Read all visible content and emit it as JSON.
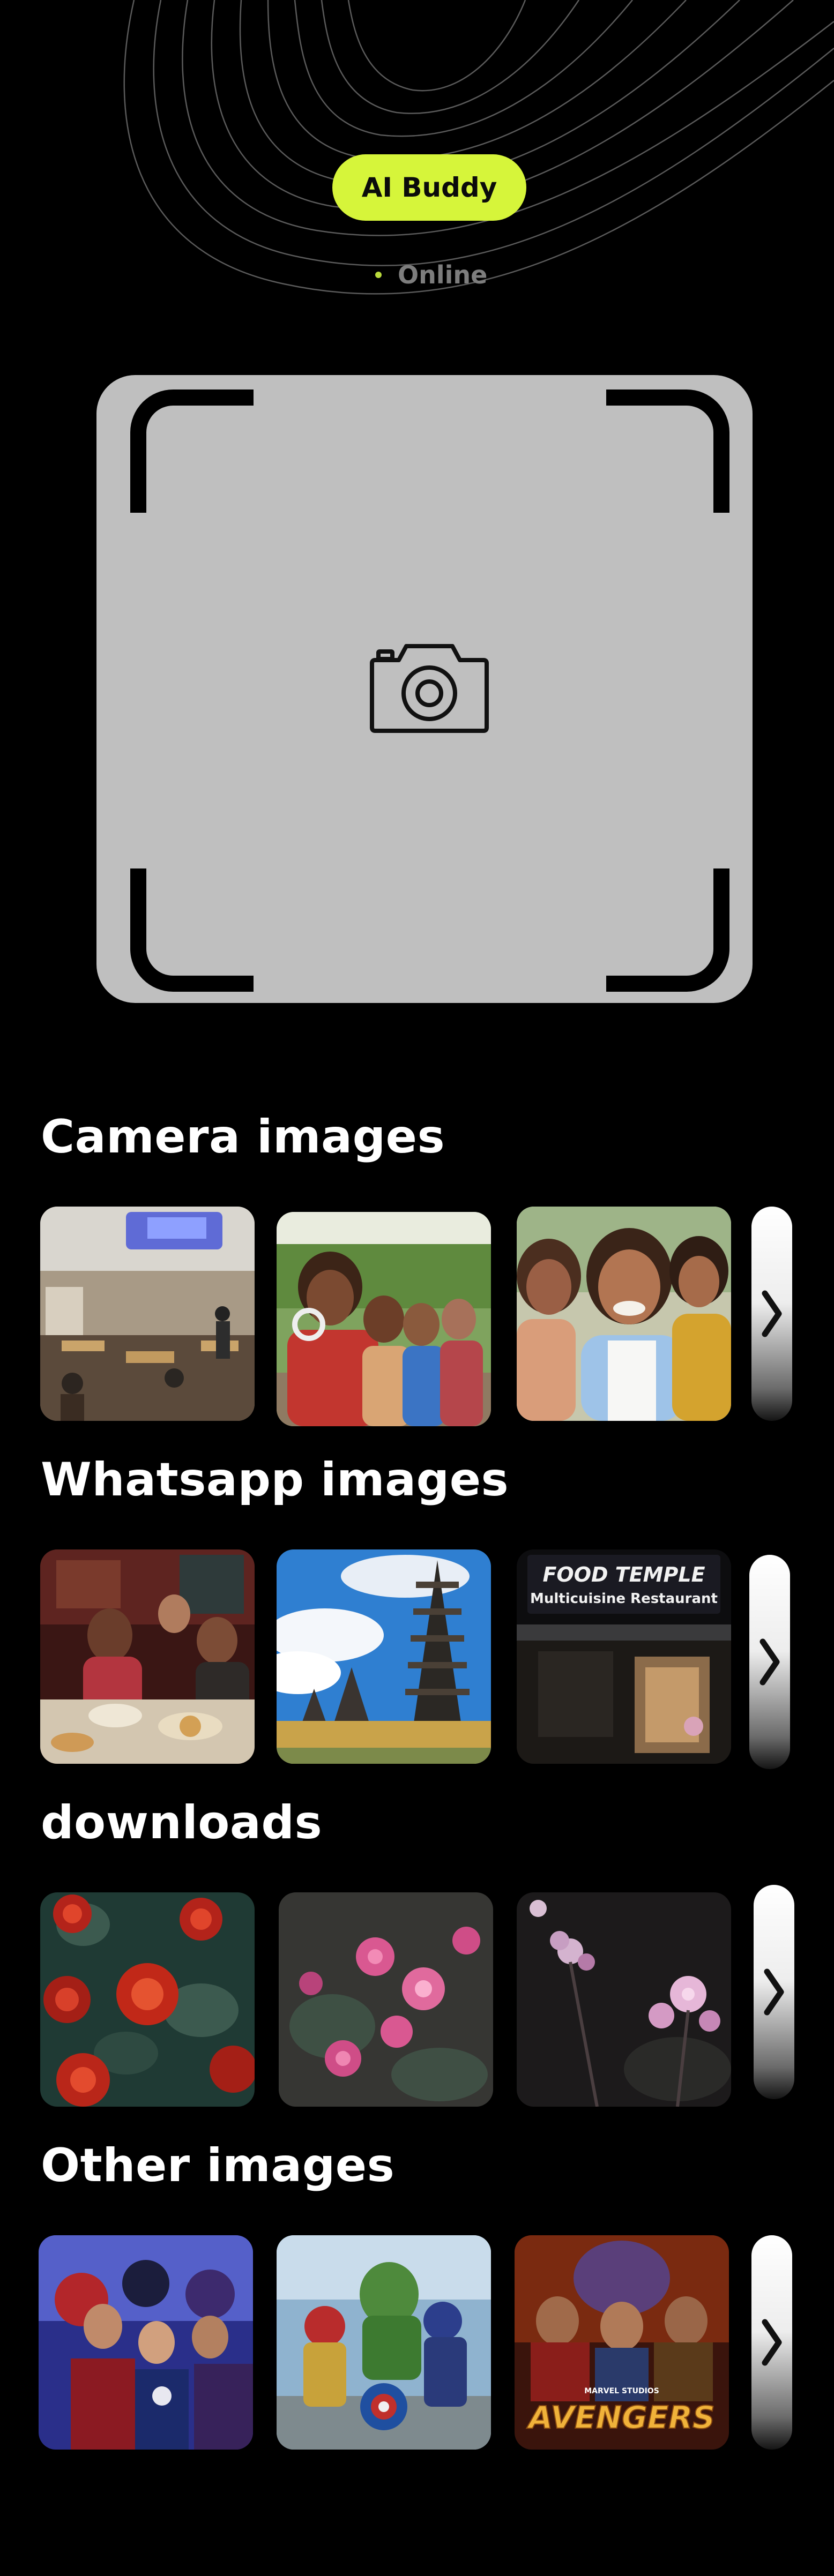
{
  "header": {
    "badge_label": "AI Buddy",
    "status_text": "Online",
    "accent_color": "#D6F53A",
    "status_dot_color": "#B9DA3C"
  },
  "camera": {
    "icon": "camera-icon",
    "frame_color": "#BFBFBF"
  },
  "sections": [
    {
      "title": "Camera images",
      "images": [
        "restaurant-interior",
        "friends-group-selfie",
        "women-selfie"
      ],
      "more_icon": "chevron-right-icon"
    },
    {
      "title": "Whatsapp images",
      "images": [
        "dinner-table-friends",
        "balinese-temple-towers",
        "food-temple-restaurant-sign"
      ],
      "more_icon": "chevron-right-icon"
    },
    {
      "title": "downloads",
      "images": [
        "red-roses",
        "pink-flowers",
        "dark-pink-blossoms"
      ],
      "more_icon": "chevron-right-icon"
    },
    {
      "title": "Other images",
      "images": [
        "avengers-endgame-poster",
        "avengers-heroes-art",
        "avengers-infinity-war-poster"
      ],
      "more_icon": "chevron-right-icon"
    }
  ],
  "signs": {
    "food_temple_line1": "FOOD TEMPLE",
    "food_temple_line2": "Multicuisine Restaurant",
    "poster_brand": "AVENGERS",
    "poster_studio": "MARVEL STUDIOS"
  }
}
